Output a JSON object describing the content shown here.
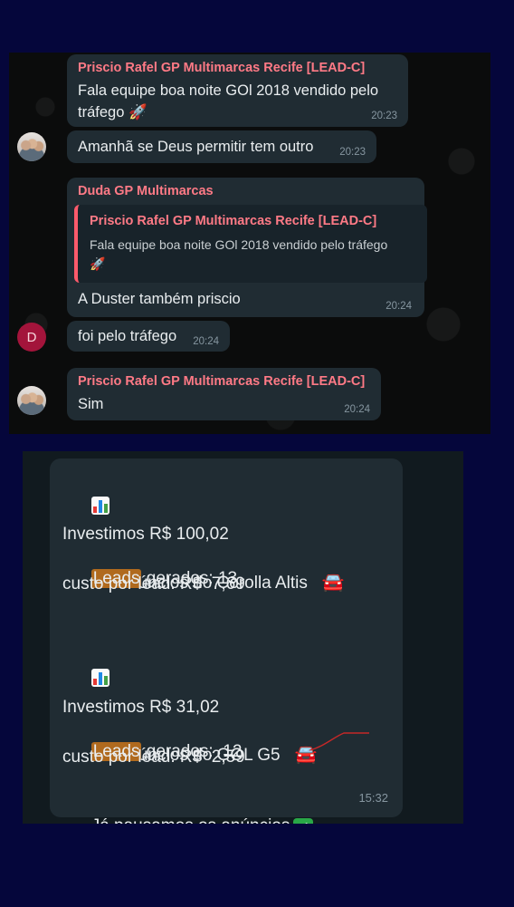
{
  "group_chat": {
    "messages": [
      {
        "sender": "Priscio Rafel GP Multimarcas Recife [LEAD-C]",
        "text_line1": "Fala equipe boa noite GOl 2018 vendido pelo",
        "text_line2": "tráfego 🚀",
        "time": "20:23"
      },
      {
        "text": "Amanhã se Deus permitir tem outro",
        "time": "20:23"
      },
      {
        "sender": "Duda GP Multimarcas",
        "quoted_sender": "Priscio Rafel GP Multimarcas Recife [LEAD-C]",
        "quoted_text_line1": "Fala equipe boa noite GOl 2018 vendido pelo tráfego",
        "quoted_text_line2": "🚀",
        "text": "A Duster também priscio",
        "time": "20:24"
      },
      {
        "avatar_letter": "D",
        "text": "foi pelo tráfego",
        "time": "20:24"
      },
      {
        "sender": "Priscio Rafel GP Multimarcas Recife [LEAD-C]",
        "text": "Sim",
        "time": "20:24"
      }
    ]
  },
  "report": {
    "section1": {
      "title": "Anúncios do Corolla Altis",
      "invest": "Investimos R$ 100,02",
      "leads_word": "Leads",
      "leads_rest": " gerados: 13",
      "cost": "custo por lead: R$  7,69"
    },
    "section2": {
      "title": "Anúncios do GOL G5",
      "invest": "Investimos R$ 31,02",
      "leads_word": "Leads",
      "leads_rest": " gerados:  12",
      "cost": "custo por lead: R$  2,59"
    },
    "closing": "Já pausamos os anúncios",
    "time": "15:32"
  },
  "icons": {
    "chart": "bar-chart-icon",
    "car": "car-icon",
    "check": "check-mark-icon",
    "rocket": "rocket-icon"
  },
  "colors": {
    "page_bg": "#05063b",
    "bubble": "#202c33",
    "sender": "#ff7a86",
    "highlight": "#b06a1e"
  }
}
